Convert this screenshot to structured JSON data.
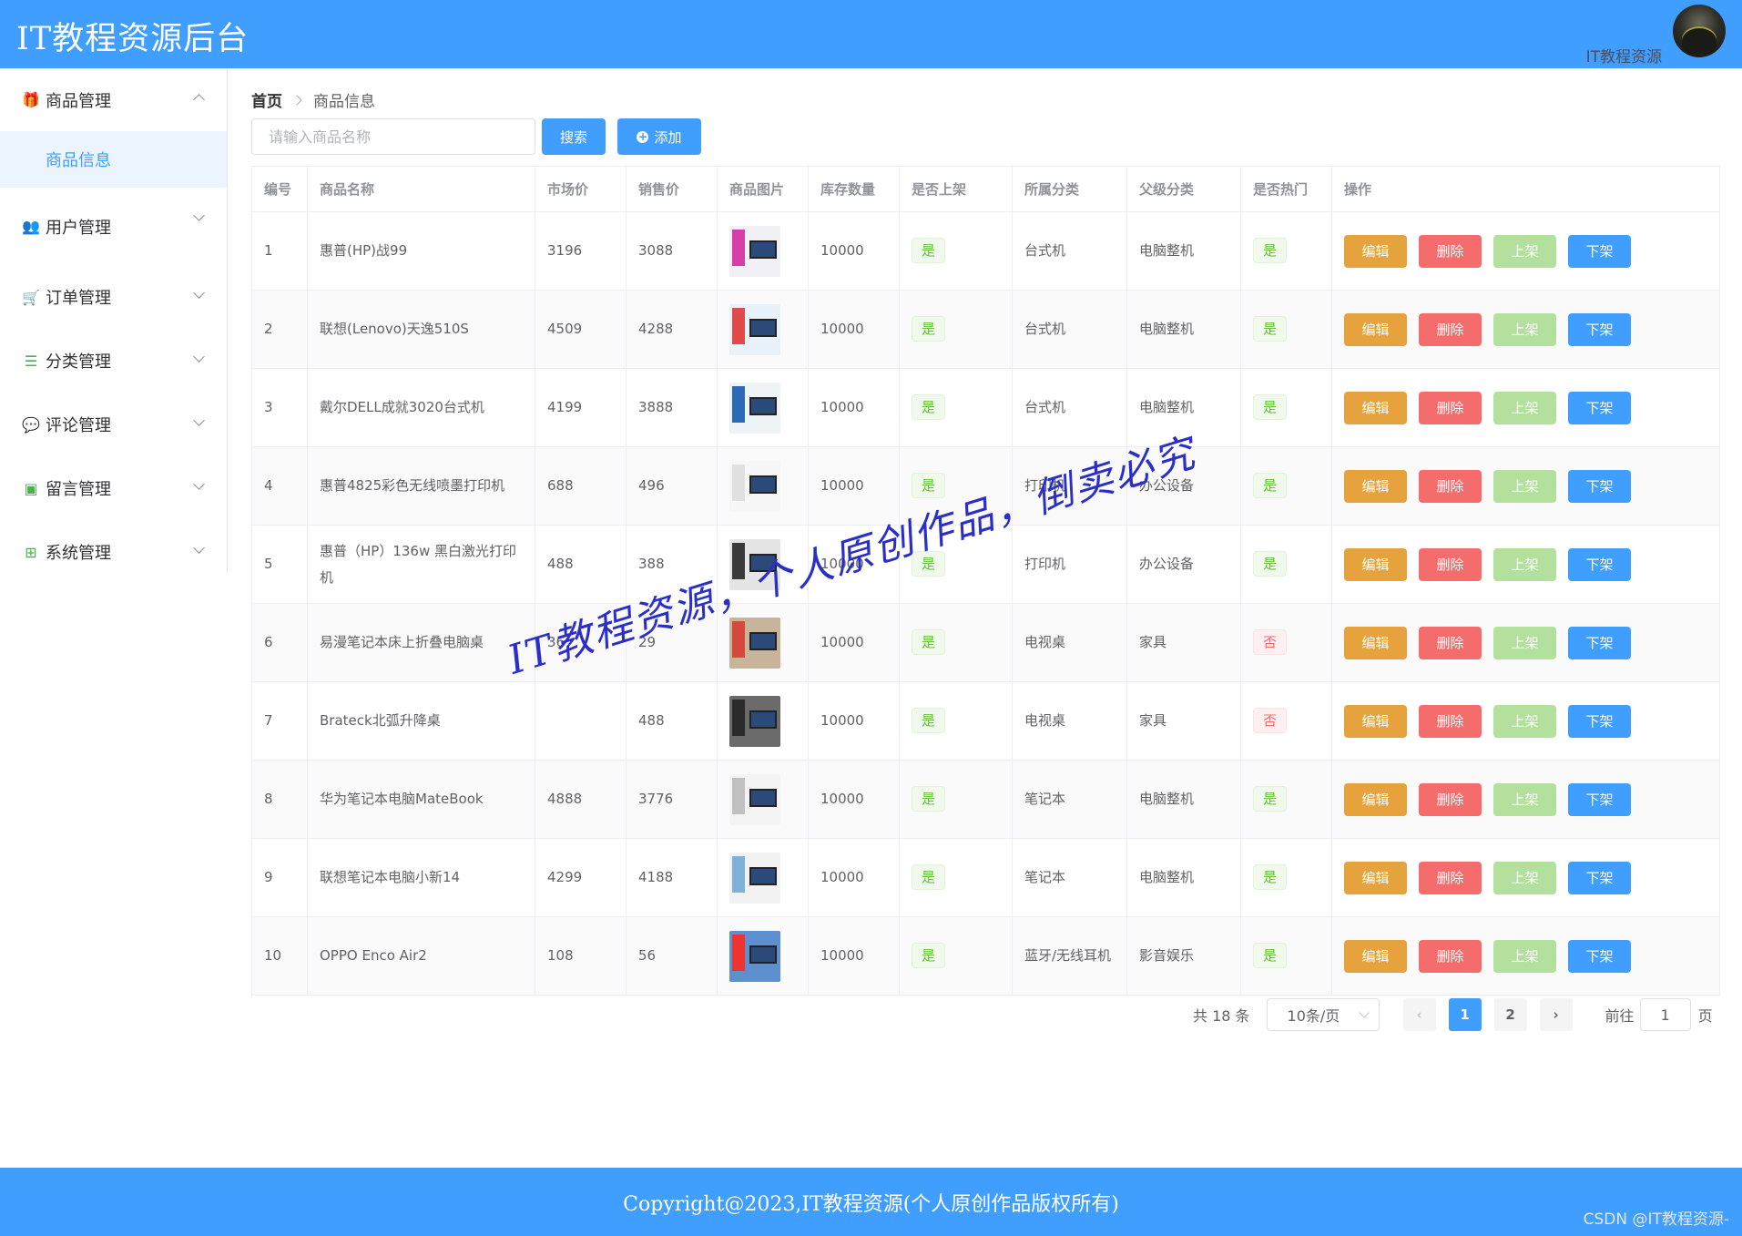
{
  "header": {
    "title": "IT教程资源后台",
    "user_name": "IT教程资源"
  },
  "sidebar": {
    "items": [
      {
        "label": "商品管理",
        "icon": "gift-icon",
        "glyph": "🎁",
        "expanded": true,
        "children": [
          {
            "label": "商品信息",
            "active": true
          }
        ]
      },
      {
        "label": "用户管理",
        "icon": "users-icon",
        "glyph": "👥"
      },
      {
        "label": "订单管理",
        "icon": "cart-icon",
        "glyph": "🛒"
      },
      {
        "label": "分类管理",
        "icon": "list-icon",
        "glyph": "☰"
      },
      {
        "label": "评论管理",
        "icon": "comment-icon",
        "glyph": "💬"
      },
      {
        "label": "留言管理",
        "icon": "message-icon",
        "glyph": "▣"
      },
      {
        "label": "系统管理",
        "icon": "windows-icon",
        "glyph": "⊞"
      }
    ]
  },
  "breadcrumb": {
    "home": "首页",
    "current": "商品信息"
  },
  "toolbar": {
    "search_placeholder": "请输入商品名称",
    "search_label": "搜索",
    "add_label": "添加"
  },
  "table": {
    "headers": [
      "编号",
      "商品名称",
      "市场价",
      "销售价",
      "商品图片",
      "库存数量",
      "是否上架",
      "所属分类",
      "父级分类",
      "是否热门",
      "操作"
    ],
    "action_labels": {
      "edit": "编辑",
      "delete": "删除",
      "up": "上架",
      "down": "下架"
    },
    "rows": [
      {
        "id": "1",
        "name": "惠普(HP)战99",
        "market": "3196",
        "price": "3088",
        "stock": "10000",
        "on_sale": "是",
        "category": "台式机",
        "parent": "电脑整机",
        "hot": "是"
      },
      {
        "id": "2",
        "name": "联想(Lenovo)天逸510S",
        "market": "4509",
        "price": "4288",
        "stock": "10000",
        "on_sale": "是",
        "category": "台式机",
        "parent": "电脑整机",
        "hot": "是"
      },
      {
        "id": "3",
        "name": "戴尔DELL成就3020台式机",
        "market": "4199",
        "price": "3888",
        "stock": "10000",
        "on_sale": "是",
        "category": "台式机",
        "parent": "电脑整机",
        "hot": "是"
      },
      {
        "id": "4",
        "name": "惠普4825彩色无线喷墨打印机",
        "market": "688",
        "price": "496",
        "stock": "10000",
        "on_sale": "是",
        "category": "打印机",
        "parent": "办公设备",
        "hot": "是"
      },
      {
        "id": "5",
        "name": "惠普（HP）136w 黑白激光打印机",
        "market": "488",
        "price": "388",
        "stock": "10000",
        "on_sale": "是",
        "category": "打印机",
        "parent": "办公设备",
        "hot": "是"
      },
      {
        "id": "6",
        "name": "易漫笔记本床上折叠电脑桌",
        "market": "36",
        "price": "29",
        "stock": "10000",
        "on_sale": "是",
        "category": "电视桌",
        "parent": "家具",
        "hot": "否"
      },
      {
        "id": "7",
        "name": "Brateck北弧升降桌",
        "market": "",
        "price": "488",
        "stock": "10000",
        "on_sale": "是",
        "category": "电视桌",
        "parent": "家具",
        "hot": "否"
      },
      {
        "id": "8",
        "name": "华为笔记本电脑MateBook",
        "market": "4888",
        "price": "3776",
        "stock": "10000",
        "on_sale": "是",
        "category": "笔记本",
        "parent": "电脑整机",
        "hot": "是"
      },
      {
        "id": "9",
        "name": "联想笔记本电脑小新14",
        "market": "4299",
        "price": "4188",
        "stock": "10000",
        "on_sale": "是",
        "category": "笔记本",
        "parent": "电脑整机",
        "hot": "是"
      },
      {
        "id": "10",
        "name": "OPPO Enco Air2",
        "market": "108",
        "price": "56",
        "stock": "10000",
        "on_sale": "是",
        "category": "蓝牙/无线耳机",
        "parent": "影音娱乐",
        "hot": "是"
      }
    ]
  },
  "pagination": {
    "total_text": "共 18 条",
    "page_size": "10条/页",
    "pages": [
      "1",
      "2"
    ],
    "current": "1",
    "goto_label": "前往",
    "goto_value": "1",
    "page_suffix": "页"
  },
  "watermark": "IT教程资源，个人原创作品，倒卖必究",
  "footer": {
    "copyright": "Copyright@2023,IT教程资源(个人原创作品版权所有)",
    "csdn": "CSDN @IT教程资源-"
  },
  "colors": {
    "primary": "#409eff",
    "warning": "#e6a23c",
    "danger": "#f56c6c",
    "success_light": "#b3e19d",
    "success": "#67c23a"
  }
}
